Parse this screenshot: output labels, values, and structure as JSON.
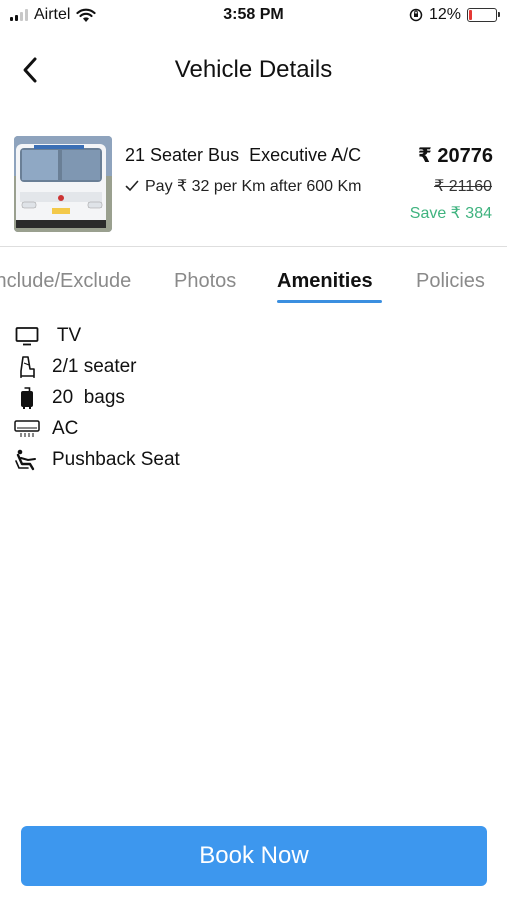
{
  "status_bar": {
    "carrier": "Airtel",
    "time": "3:58 PM",
    "battery_percent": "12%",
    "battery_level": 0.12,
    "battery_color": "#e53935"
  },
  "header": {
    "back_icon": "chevron-left-icon",
    "title": "Vehicle Details"
  },
  "vehicle": {
    "image": "bus-photo",
    "name": "21 Seater Bus  Executive A/C",
    "price": "₹ 20776",
    "pay_line": "Pay ₹ 32 per Km after 600 Km",
    "old_price": "₹ 21160",
    "save_text": "Save ₹ 384",
    "save_color": "#3fb37f"
  },
  "tabs": [
    {
      "label": "Include/Exclude",
      "active": false
    },
    {
      "label": "Photos",
      "active": false
    },
    {
      "label": "Amenities",
      "active": true
    },
    {
      "label": "Policies",
      "active": false
    }
  ],
  "tab_accent_color": "#3b8fe0",
  "amenities": [
    {
      "icon": "tv-icon",
      "label": " TV"
    },
    {
      "icon": "seat-icon",
      "label": "2/1 seater"
    },
    {
      "icon": "luggage-icon",
      "label": "20  bags"
    },
    {
      "icon": "ac-icon",
      "label": "AC"
    },
    {
      "icon": "pushback-seat-icon",
      "label": "Pushback Seat"
    }
  ],
  "book_button": {
    "label": "Book Now",
    "color": "#3d97ee"
  }
}
